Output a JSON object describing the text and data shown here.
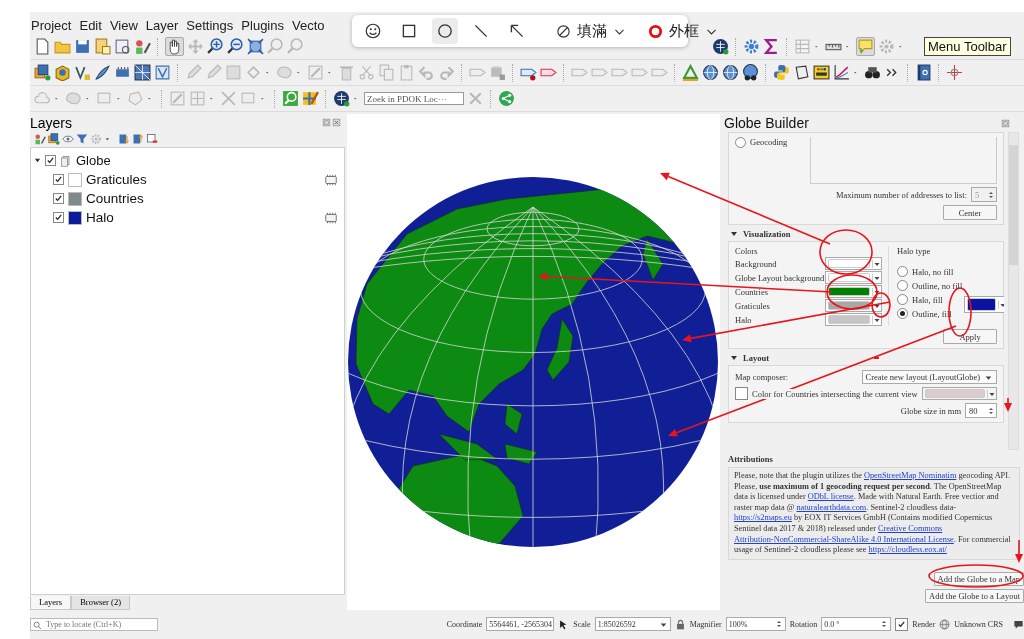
{
  "menu_bar": {
    "items": [
      {
        "label": "Project"
      },
      {
        "label": "Edit"
      },
      {
        "label": "View"
      },
      {
        "label": "Layer"
      },
      {
        "label": "Settings"
      },
      {
        "label": "Plugins"
      },
      {
        "label": "Vecto"
      }
    ]
  },
  "annotation_toolbar": {
    "tools": [
      {
        "kind": "emoji",
        "selected": false
      },
      {
        "kind": "rectangle",
        "selected": false
      },
      {
        "kind": "ellipse",
        "selected": true
      },
      {
        "kind": "line",
        "selected": false
      },
      {
        "kind": "arrow",
        "selected": false
      }
    ],
    "fill": {
      "label": "填滿"
    },
    "outline": {
      "label": "外框"
    }
  },
  "toolbars": {
    "pan_selected": true,
    "map_tips_selected": true,
    "locator_search": {
      "placeholder": "Zoek in PDOK Loc···"
    },
    "tooltip": "Menu Toolbar"
  },
  "layers_panel": {
    "title": "Layers",
    "tree": [
      {
        "label": "Globe",
        "checked": true,
        "expanded": true,
        "children": [
          {
            "label": "Graticules",
            "checked": true,
            "color": "#ffffff",
            "temporary": true
          },
          {
            "label": "Countries",
            "checked": true,
            "color": "#7f8a8c",
            "temporary": false
          },
          {
            "label": "Halo",
            "checked": true,
            "color": "#0c1a9c",
            "temporary": true
          }
        ]
      }
    ]
  },
  "globe_builder": {
    "title": "Globe Builder",
    "geocoding": {
      "label": "Geocoding",
      "selected": false,
      "max_label": "Maximum number of addresses to list:",
      "max_value": "5",
      "center_button": "Center"
    },
    "visualization": {
      "title": "Visualization",
      "expanded": true,
      "colors_label": "Colors",
      "colors": [
        {
          "label": "Background",
          "color": "#ffffff"
        },
        {
          "label": "Globe Layout background",
          "color": "#ffffff"
        },
        {
          "label": "Countries",
          "color": "#008000"
        },
        {
          "label": "Graticules",
          "color": "#a8a8a8"
        },
        {
          "label": "Halo",
          "color": "#c6c6c6"
        }
      ],
      "halo_type_label": "Halo type",
      "halo_types": [
        {
          "label": "Halo, no fill",
          "selected": false
        },
        {
          "label": "Outline, no fill",
          "selected": false
        },
        {
          "label": "Halo, fill",
          "selected": false
        },
        {
          "label": "Outline, fill",
          "selected": true
        }
      ],
      "halo_color_button": {
        "color": "#0a14a0"
      },
      "apply_button": "Apply"
    },
    "layout": {
      "title": "Layout",
      "expanded": true,
      "composer_label": "Map composer:",
      "composer_value": "Create new layout (LayoutGlobe)",
      "intersect_label": "Color for Countries intersecting the current view",
      "intersect_checked": false,
      "intersect_color_button": {
        "color": "#dccbcb"
      },
      "size_label": "Globe size in mm",
      "size_value": "80"
    },
    "attributions": {
      "title": "Attributions",
      "segments": [
        {
          "text": "Please, note that the plugin utilizes the ",
          "link": false
        },
        {
          "text": "OpenStreetMap Nominatim",
          "link": true
        },
        {
          "text": " geocoding API. Please, **use maximum of 1 geocoding request per second**. The OpenStreetMap data is licensed under ",
          "link": false
        },
        {
          "text": "ODbL license",
          "link": true
        },
        {
          "text": ". Made with Natural Earth. Free vectior and raster map data @ ",
          "link": false
        },
        {
          "text": "naturalearthdata.com",
          "link": true
        },
        {
          "text": ". Sentinel-2 cloudless data- ",
          "link": false
        },
        {
          "text": "https://s2maps.eu",
          "link": true
        },
        {
          "text": " by EOX IT Services GmbH (Contains modified Copernicus Sentinel data 2017 & 2018) released under ",
          "link": false
        },
        {
          "text": "Creative Commons",
          "link": true
        },
        {
          "text": "Attribution-NonCommercial-ShareAlike 4.0 International License",
          "link": true
        },
        {
          "text": ". For commercial usage of Sentinel-2 cloudless please see ",
          "link": false
        },
        {
          "text": "https://cloudless.eox.at/",
          "link": true
        }
      ]
    },
    "buttons": [
      {
        "label": "Add the Globe to a Map"
      },
      {
        "label": "Add the Globe to a Layout"
      }
    ]
  },
  "bottom_tabs": [
    {
      "label": "Layers",
      "selected": true
    },
    {
      "label": "Browser (2)",
      "selected": false
    }
  ],
  "status_bar": {
    "locate_placeholder": "Type to locate (Ctrl+K)",
    "coordinate_label": "Coordinate",
    "coordinate": "5564461, -2565304",
    "scale_label": "Scale",
    "scale": "1:85026592",
    "magnifier_label": "Magnifier",
    "magnifier": "100%",
    "rotation_label": "Rotation",
    "rotation": "0.0 °",
    "render_label": "Render",
    "render_checked": true,
    "crs": "Unknown CRS"
  }
}
